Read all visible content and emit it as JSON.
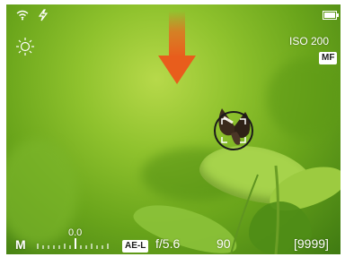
{
  "top": {
    "wifi_icon": "wifi-icon",
    "flash_icon": "flash-icon",
    "battery_icon": "battery-icon"
  },
  "left": {
    "wb_icon": "sun-icon"
  },
  "right": {
    "iso": "ISO 200",
    "focus_mode": "MF"
  },
  "guide": {
    "arrow_icon": "down-arrow-icon",
    "arrow_color": "#e85d1c"
  },
  "focus": {
    "icon": "focus-reticle-icon"
  },
  "bottom": {
    "mode": "M",
    "exposure_value": "0.0",
    "ae_lock": "AE-L",
    "aperture": "f/5.6",
    "shutter": "90",
    "shots_remaining": "[9999]"
  }
}
